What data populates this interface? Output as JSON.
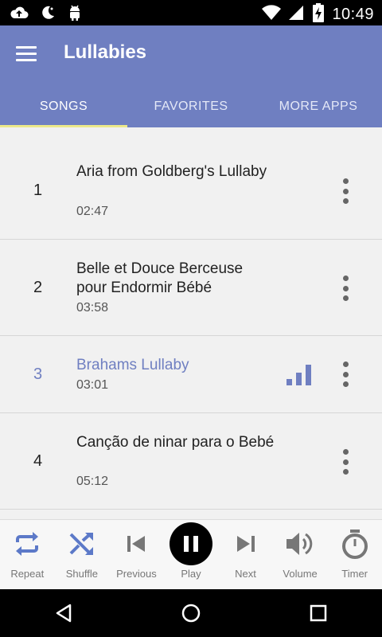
{
  "status_bar": {
    "time": "10:49"
  },
  "app_bar": {
    "title": "Lullabies"
  },
  "tabs": [
    {
      "label": "SONGS",
      "active": true
    },
    {
      "label": "FAVORITES",
      "active": false
    },
    {
      "label": "MORE APPS",
      "active": false
    }
  ],
  "songs": [
    {
      "number": "1",
      "title": "Aria from Goldberg's Lullaby",
      "duration": "02:47",
      "playing": false
    },
    {
      "number": "2",
      "title": "Belle et Douce Berceuse pour Endormir Bébé",
      "duration": "03:58",
      "playing": false
    },
    {
      "number": "3",
      "title": "Brahams Lullaby",
      "duration": "03:01",
      "playing": true
    },
    {
      "number": "4",
      "title": "Canção de ninar para o Bebé",
      "duration": "05:12",
      "playing": false
    }
  ],
  "player": {
    "repeat_label": "Repeat",
    "shuffle_label": "Shuffle",
    "previous_label": "Previous",
    "play_label": "Play",
    "next_label": "Next",
    "volume_label": "Volume",
    "timer_label": "Timer"
  },
  "colors": {
    "primary": "#6f7fc1",
    "tab_indicator": "#ece88a",
    "background": "#f1f1f1",
    "control_blue": "#5c79c8"
  },
  "icons": {
    "status": [
      "cloud-upload-icon",
      "moon-icon",
      "android-icon",
      "wifi-icon",
      "signal-icon",
      "battery-charging-icon"
    ],
    "controls": [
      "repeat-icon",
      "shuffle-icon",
      "skip-previous-icon",
      "pause-icon",
      "skip-next-icon",
      "volume-icon",
      "timer-icon"
    ],
    "nav": [
      "back-icon",
      "home-icon",
      "recents-icon"
    ]
  }
}
